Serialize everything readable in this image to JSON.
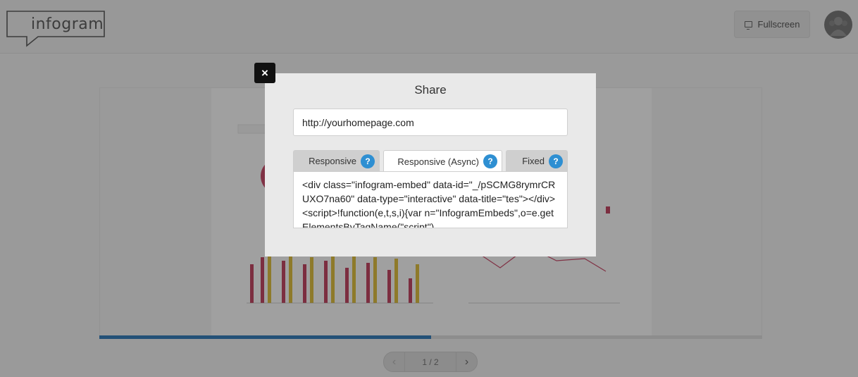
{
  "header": {
    "logo_text": "infogram",
    "fullscreen_label": "Fullscreen",
    "icons": {
      "fullscreen": "monitor-icon",
      "avatar": "user-group-icon"
    }
  },
  "canvas": {
    "progress": 0.5
  },
  "pager": {
    "prev_icon": "chevron-left-icon",
    "next_icon": "chevron-right-icon",
    "page_label": "1 / 2"
  },
  "modal": {
    "close_label": "×",
    "title": "Share",
    "url_value": "http://yourhomepage.com",
    "tabs": [
      {
        "label": "Responsive",
        "help": "?",
        "active": false
      },
      {
        "label": "Responsive (Async)",
        "help": "?",
        "active": true
      },
      {
        "label": "Fixed",
        "help": "?",
        "active": false
      }
    ],
    "embed_code": "<div class=\"infogram-embed\" data-id=\"_/pSCMG8rymrCRUXO7na60\" data-type=\"interactive\" data-title=\"tes\"></div><script>!function(e,t,s,i){var n=\"InfogramEmbeds\",o=e.getElementsByTagName(\"script\")"
  },
  "colors": {
    "accent": "#2e8fd2",
    "progress": "#1f6fb0",
    "close_button": "#111111"
  }
}
